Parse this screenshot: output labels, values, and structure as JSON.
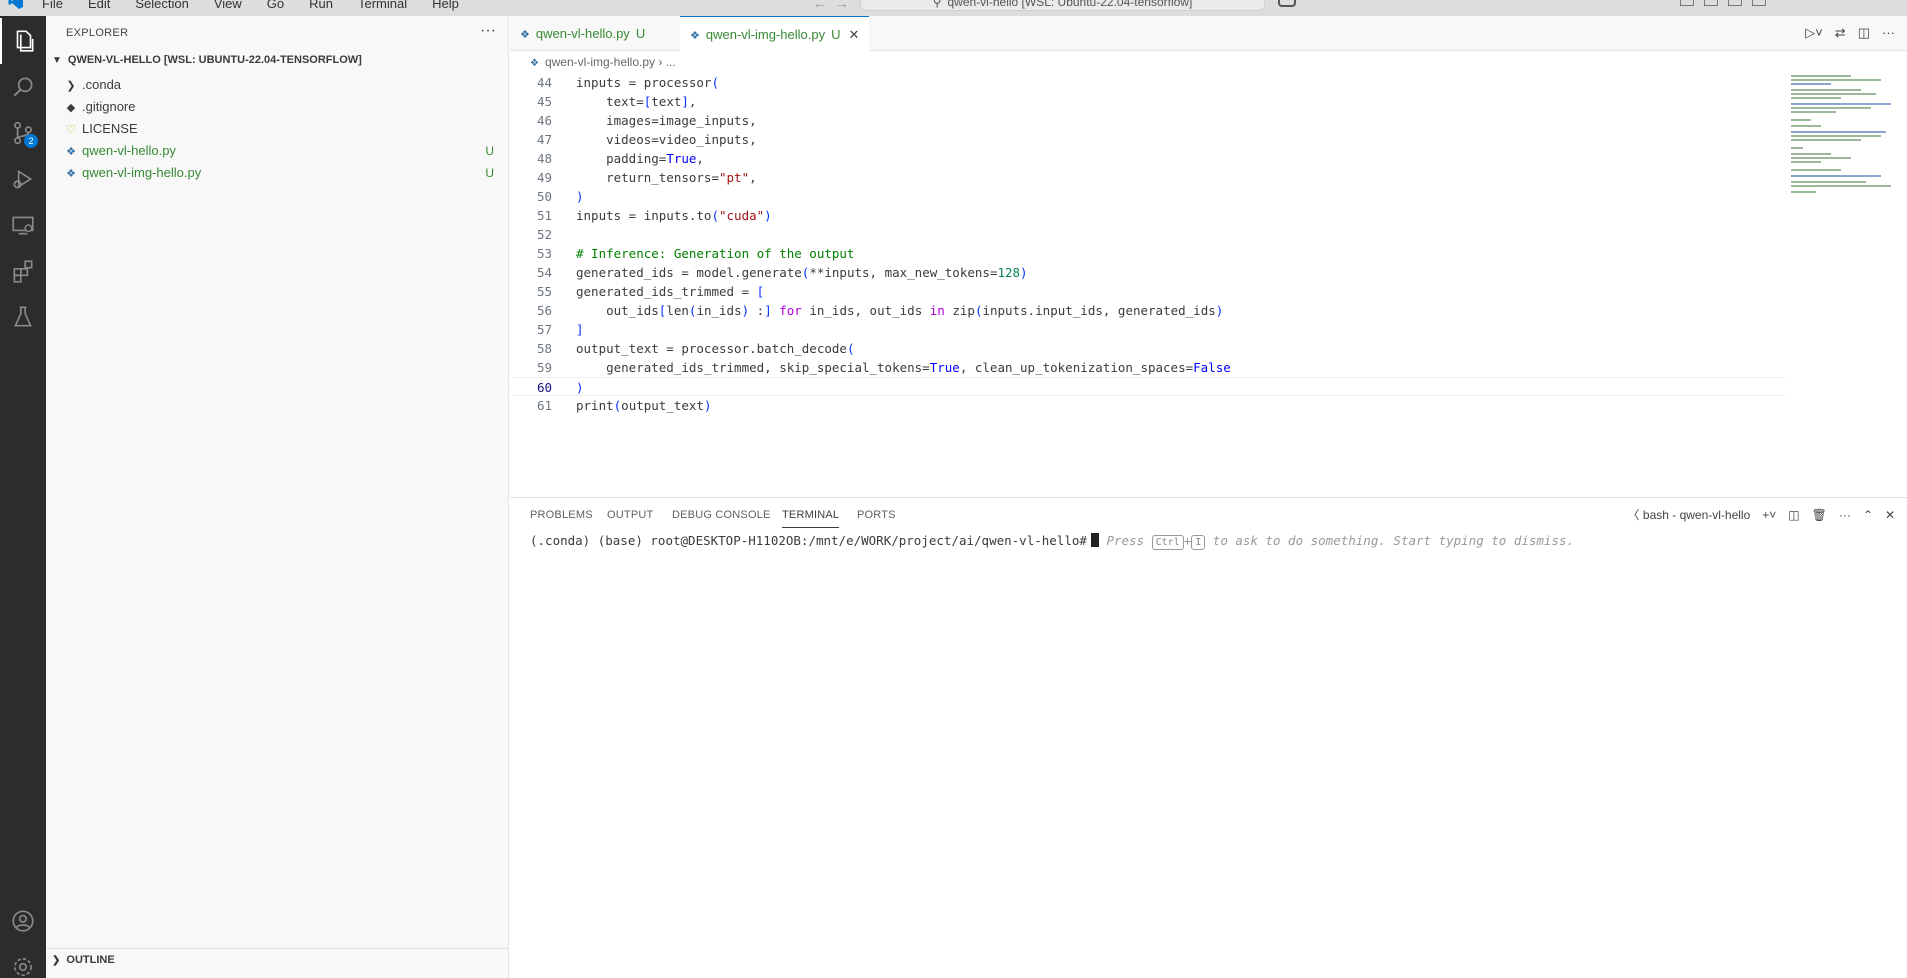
{
  "menu": [
    "File",
    "Edit",
    "Selection",
    "View",
    "Go",
    "Run",
    "Terminal",
    "Help"
  ],
  "command_center": "qwen-vl-hello [WSL: Ubuntu-22.04-tensorflow]",
  "activity_bar": {
    "source_control_badge": "2"
  },
  "explorer": {
    "header": "EXPLORER",
    "more": "···",
    "root": "QWEN-VL-HELLO [WSL: UBUNTU-22.04-TENSORFLOW]",
    "items": [
      {
        "label": ".conda",
        "status": ""
      },
      {
        "label": ".gitignore",
        "status": ""
      },
      {
        "label": "LICENSE",
        "status": ""
      },
      {
        "label": "qwen-vl-hello.py",
        "status": "U"
      },
      {
        "label": "qwen-vl-img-hello.py",
        "status": "U"
      }
    ],
    "outline": "OUTLINE"
  },
  "tabs": [
    {
      "label": "qwen-vl-hello.py",
      "status": "U"
    },
    {
      "label": "qwen-vl-img-hello.py",
      "status": "U"
    }
  ],
  "breadcrumb": {
    "file": "qwen-vl-img-hello.py",
    "rest": "..."
  },
  "code": {
    "line_numbers": [
      "44",
      "45",
      "46",
      "47",
      "48",
      "49",
      "50",
      "51",
      "52",
      "53",
      "54",
      "55",
      "56",
      "57",
      "58",
      "59",
      "60",
      "61"
    ]
  },
  "panel": {
    "tabs": [
      "PROBLEMS",
      "OUTPUT",
      "DEBUG CONSOLE",
      "TERMINAL",
      "PORTS"
    ],
    "terminal_name": "bash - qwen-vl-hello",
    "prompt": "(.conda) (base) root@DESKTOP-H1102OB:/mnt/e/WORK/project/ai/qwen-vl-hello#",
    "hint_press": "Press",
    "hint_key1": "Ctrl",
    "hint_plus": "+",
    "hint_key2": "I",
    "hint_rest": "to ask to do something. Start typing to dismiss."
  },
  "colors": {
    "activity_bar": "#2c2c2c",
    "accent": "#0078d4",
    "untracked": "#388a34"
  }
}
